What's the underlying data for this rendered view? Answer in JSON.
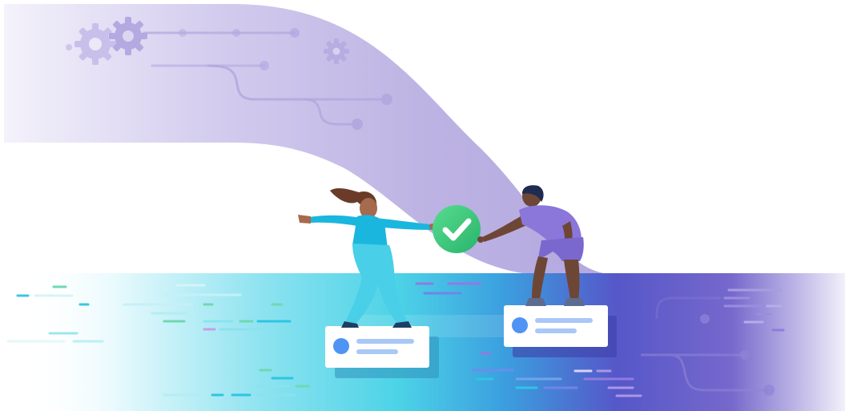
{
  "scene": {
    "description_free": true,
    "colors": {
      "upper_band_light": "#f3f1fb",
      "upper_band_mid": "#c9c2e8",
      "upper_band_dark": "#b7aee1",
      "lower_band_light": "#e7f9fc",
      "lower_band_cyan": "#4fd4e8",
      "lower_band_blue": "#3f6fd6",
      "lower_band_purple": "#5b4fc0",
      "check_green": "#3fcb7e",
      "card_dot": "#4f94f5",
      "card_line": "#a9c8f7",
      "woman_shirt": "#1bb6dd",
      "woman_pants": "#49cfe7",
      "man_shirt": "#8a77d9",
      "man_shorts": "#7a68cf"
    },
    "icons": [
      "gear-icon",
      "gear-icon",
      "gear-icon",
      "check-icon",
      "avatar-dot-icon",
      "avatar-dot-icon"
    ]
  }
}
